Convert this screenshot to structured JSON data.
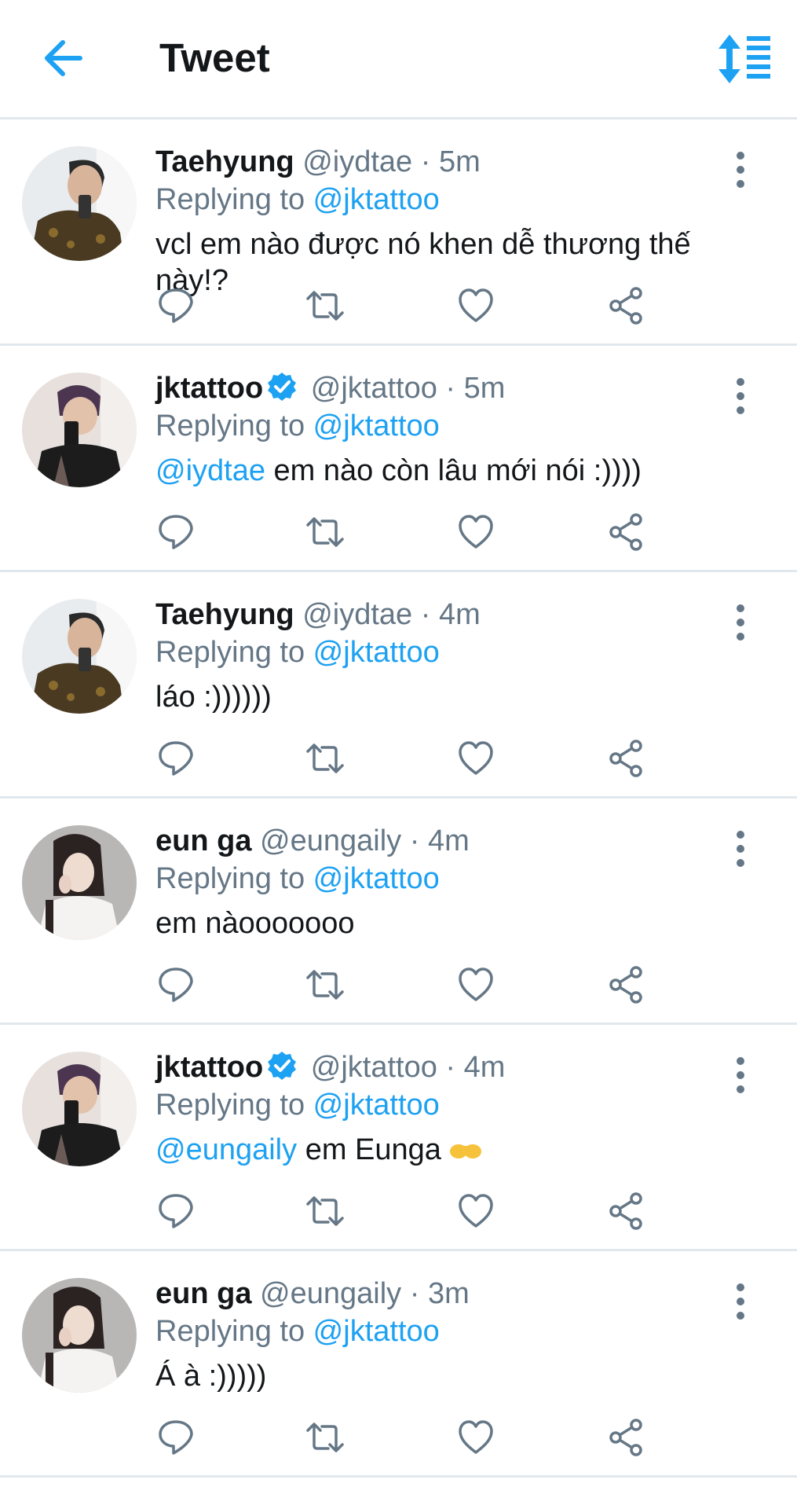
{
  "header": {
    "title": "Tweet"
  },
  "tweets": [
    {
      "name": "Taehyung",
      "verified": false,
      "handle": "@iydtae",
      "dot": " · ",
      "time": "5m",
      "replying_prefix": "Replying to ",
      "replying_to": "@jktattoo",
      "mention": "",
      "text": "vcl em nào được nó khen dễ thương thế này!?"
    },
    {
      "name": "jktattoo",
      "verified": true,
      "handle": "@jktattoo",
      "dot": " · ",
      "time": "5m",
      "replying_prefix": "Replying to ",
      "replying_to": "@jktattoo",
      "mention": "@iydtae",
      "text": " em nào còn lâu mới nói :))))"
    },
    {
      "name": "Taehyung",
      "verified": false,
      "handle": "@iydtae",
      "dot": " · ",
      "time": "4m",
      "replying_prefix": "Replying to ",
      "replying_to": "@jktattoo",
      "mention": "",
      "text": "láo :))))))"
    },
    {
      "name": "eun ga",
      "verified": false,
      "handle": "@eungaily",
      "dot": " · ",
      "time": "4m",
      "replying_prefix": "Replying to ",
      "replying_to": "@jktattoo",
      "mention": "",
      "text": "em nàooooooo"
    },
    {
      "name": "jktattoo",
      "verified": true,
      "handle": "@jktattoo",
      "dot": " · ",
      "time": "4m",
      "replying_prefix": "Replying to ",
      "replying_to": "@jktattoo",
      "mention": "@eungaily",
      "text": " em Eunga ",
      "emoji": "👉👈"
    },
    {
      "name": "eun ga",
      "verified": false,
      "handle": "@eungaily",
      "dot": " · ",
      "time": "3m",
      "replying_prefix": "Replying to ",
      "replying_to": "@jktattoo",
      "mention": "",
      "text": "Á à :)))))"
    }
  ],
  "colors": {
    "accent": "#1da1f2",
    "secondary_text": "#657786",
    "divider": "#e1e8ed"
  }
}
